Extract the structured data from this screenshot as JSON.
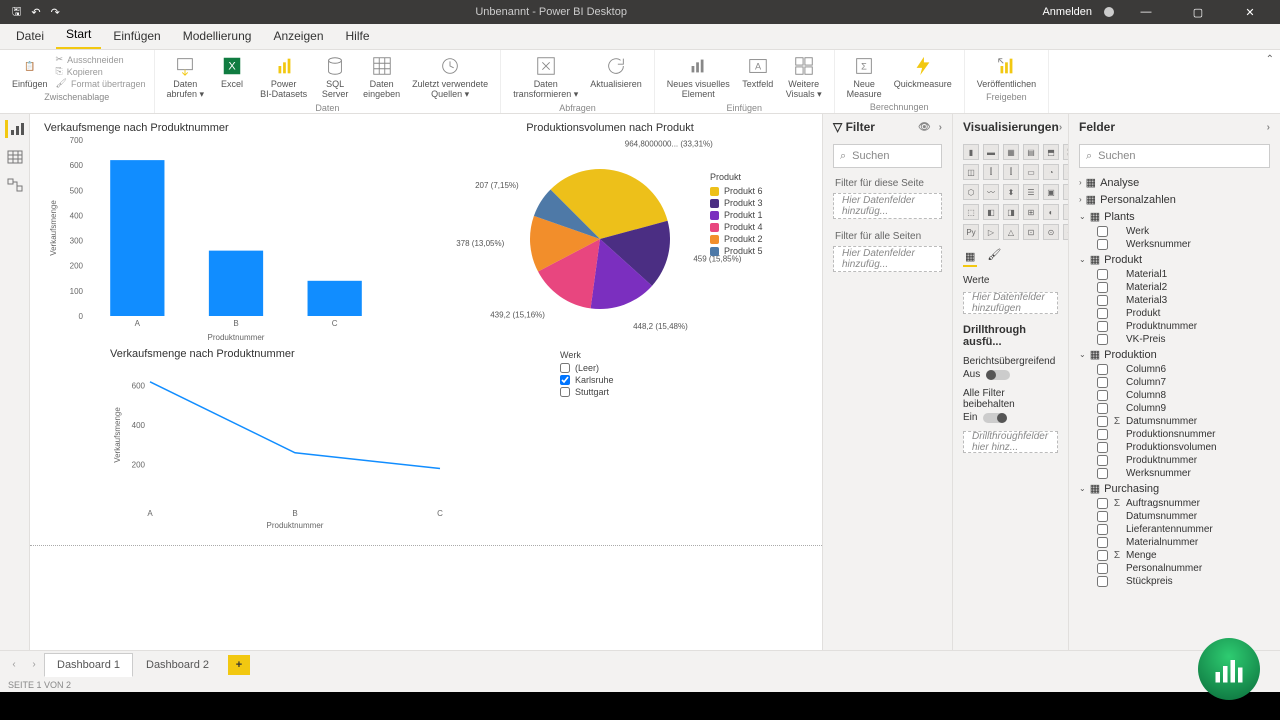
{
  "titlebar": {
    "title": "Unbenannt - Power BI Desktop",
    "signin": "Anmelden"
  },
  "menu": {
    "file": "Datei",
    "start": "Start",
    "insert": "Einfügen",
    "modeling": "Modellierung",
    "view": "Anzeigen",
    "help": "Hilfe"
  },
  "clipboard": {
    "paste": "Einfügen",
    "cut": "Ausschneiden",
    "copy": "Kopieren",
    "format": "Format übertragen",
    "label": "Zwischenablage"
  },
  "ribbon": {
    "data": "Daten\nabrufen ▾",
    "excel": "Excel",
    "pbi": "Power\nBI-Datasets",
    "sql": "SQL\nServer",
    "enter": "Daten\neingeben",
    "recent": "Zuletzt verwendete\nQuellen ▾",
    "transform": "Daten\ntransformieren ▾",
    "refresh": "Aktualisieren",
    "newviz": "Neues visuelles\nElement",
    "textbox": "Textfeld",
    "more": "Weitere\nVisuals ▾",
    "measure": "Neue\nMeasure",
    "quick": "Quickmeasure",
    "publish": "Veröffentlichen",
    "g_data": "Daten",
    "g_query": "Abfragen",
    "g_insert": "Einfügen",
    "g_calc": "Berechnungen",
    "g_share": "Freigeben"
  },
  "filter": {
    "title": "Filter",
    "search": "Suchen",
    "page": "Filter für diese Seite",
    "all": "Filter für alle Seiten",
    "drop": "Hier Datenfelder hinzufüg..."
  },
  "viz": {
    "title": "Visualisierungen",
    "values": "Werte",
    "drop": "Hier Datenfelder hinzufügen",
    "drill": "Drillthrough ausfü...",
    "cross": "Berichtsübergreifend",
    "off": "Aus",
    "keep": "Alle Filter beibehalten",
    "on": "Ein",
    "dtdrop": "Drillthroughfelder hier hinz..."
  },
  "fields": {
    "title": "Felder",
    "search": "Suchen",
    "tables": [
      {
        "name": "Analyse",
        "fields": []
      },
      {
        "name": "Personalzahlen",
        "fields": []
      },
      {
        "name": "Plants",
        "open": true,
        "fields": [
          {
            "n": "Werk"
          },
          {
            "n": "Werksnummer"
          }
        ]
      },
      {
        "name": "Produkt",
        "open": true,
        "fields": [
          {
            "n": "Material1"
          },
          {
            "n": "Material2"
          },
          {
            "n": "Material3"
          },
          {
            "n": "Produkt"
          },
          {
            "n": "Produktnummer"
          },
          {
            "n": "VK-Preis"
          }
        ]
      },
      {
        "name": "Produktion",
        "open": true,
        "fields": [
          {
            "n": "Column6"
          },
          {
            "n": "Column7"
          },
          {
            "n": "Column8"
          },
          {
            "n": "Column9"
          },
          {
            "n": "Datumsnummer",
            "s": true
          },
          {
            "n": "Produktionsnummer"
          },
          {
            "n": "Produktionsvolumen"
          },
          {
            "n": "Produktnummer"
          },
          {
            "n": "Werksnummer"
          }
        ]
      },
      {
        "name": "Purchasing",
        "open": true,
        "fields": [
          {
            "n": "Auftragsnummer",
            "s": true
          },
          {
            "n": "Datumsnummer"
          },
          {
            "n": "Lieferantennummer"
          },
          {
            "n": "Materialnummer"
          },
          {
            "n": "Menge",
            "s": true
          },
          {
            "n": "Personalnummer"
          },
          {
            "n": "Stückpreis"
          }
        ]
      }
    ]
  },
  "tabs": {
    "d1": "Dashboard 1",
    "d2": "Dashboard 2"
  },
  "status": "SEITE 1 VON 2",
  "chart_data": [
    {
      "type": "bar",
      "title": "Verkaufsmenge nach Produktnummer",
      "categories": [
        "A",
        "B",
        "C"
      ],
      "values": [
        620,
        260,
        140
      ],
      "xlabel": "Produktnummer",
      "ylabel": "Verkaufsmenge",
      "ylim": [
        0,
        700
      ],
      "ticks": [
        0,
        100,
        200,
        300,
        400,
        500,
        600,
        700
      ]
    },
    {
      "type": "pie",
      "title": "Produktionsvolumen nach Produkt",
      "legend_title": "Produkt",
      "series": [
        {
          "name": "Produkt 6",
          "value": 964.8,
          "pct": 33.31,
          "label": "964,8000000... (33,31%)",
          "color": "#edc01a"
        },
        {
          "name": "Produkt 3",
          "value": 459,
          "pct": 15.85,
          "label": "459 (15,85%)",
          "color": "#4b2e83"
        },
        {
          "name": "Produkt 1",
          "value": 448.2,
          "pct": 15.48,
          "label": "448,2 (15,48%)",
          "color": "#7b2fbf"
        },
        {
          "name": "Produkt 4",
          "value": 439.2,
          "pct": 15.16,
          "label": "439,2 (15,16%)",
          "color": "#e8467f"
        },
        {
          "name": "Produkt 2",
          "value": 378,
          "pct": 13.05,
          "label": "378 (13,05%)",
          "color": "#f28e2b"
        },
        {
          "name": "Produkt 5",
          "value": 207,
          "pct": 7.15,
          "label": "207 (7,15%)",
          "color": "#4e79a7"
        }
      ]
    },
    {
      "type": "line",
      "title": "Verkaufsmenge nach Produktnummer",
      "categories": [
        "A",
        "B",
        "C"
      ],
      "values": [
        620,
        260,
        180
      ],
      "xlabel": "Produktnummer",
      "ylabel": "Verkaufsmenge",
      "ticks": [
        200,
        400,
        600
      ],
      "legend_title": "Werk",
      "legend": [
        "(Leer)",
        "Karlsruhe",
        "Stuttgart"
      ]
    }
  ]
}
